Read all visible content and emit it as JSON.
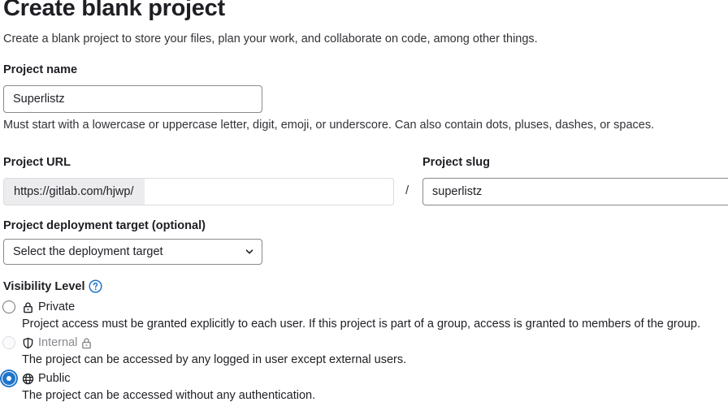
{
  "header": {
    "title": "Create blank project",
    "subtitle": "Create a blank project to store your files, plan your work, and collaborate on code, among other things."
  },
  "project_name": {
    "label": "Project name",
    "value": "Superlistz",
    "help": "Must start with a lowercase or uppercase letter, digit, emoji, or underscore. Can also contain dots, pluses, dashes, or spaces."
  },
  "project_url": {
    "label": "Project URL",
    "prefix": "https://gitlab.com/hjwp/",
    "separator": "/"
  },
  "project_slug": {
    "label": "Project slug",
    "value": "superlistz"
  },
  "deployment_target": {
    "label": "Project deployment target (optional)",
    "selected": "Select the deployment target"
  },
  "visibility": {
    "label": "Visibility Level",
    "options": [
      {
        "label": "Private",
        "icon": "lock-icon",
        "description": "Project access must be granted explicitly to each user. If this project is part of a group, access is granted to members of the group.",
        "checked": false,
        "disabled": false
      },
      {
        "label": "Internal",
        "icon": "shield-icon",
        "description": "The project can be accessed by any logged in user except external users.",
        "checked": false,
        "disabled": true
      },
      {
        "label": "Public",
        "icon": "globe-icon",
        "description": "The project can be accessed without any authentication.",
        "checked": true,
        "disabled": false
      }
    ]
  },
  "colors": {
    "accent": "#1f75cb",
    "text": "#1f1e24",
    "muted": "#89888d",
    "border": "#89888d"
  }
}
